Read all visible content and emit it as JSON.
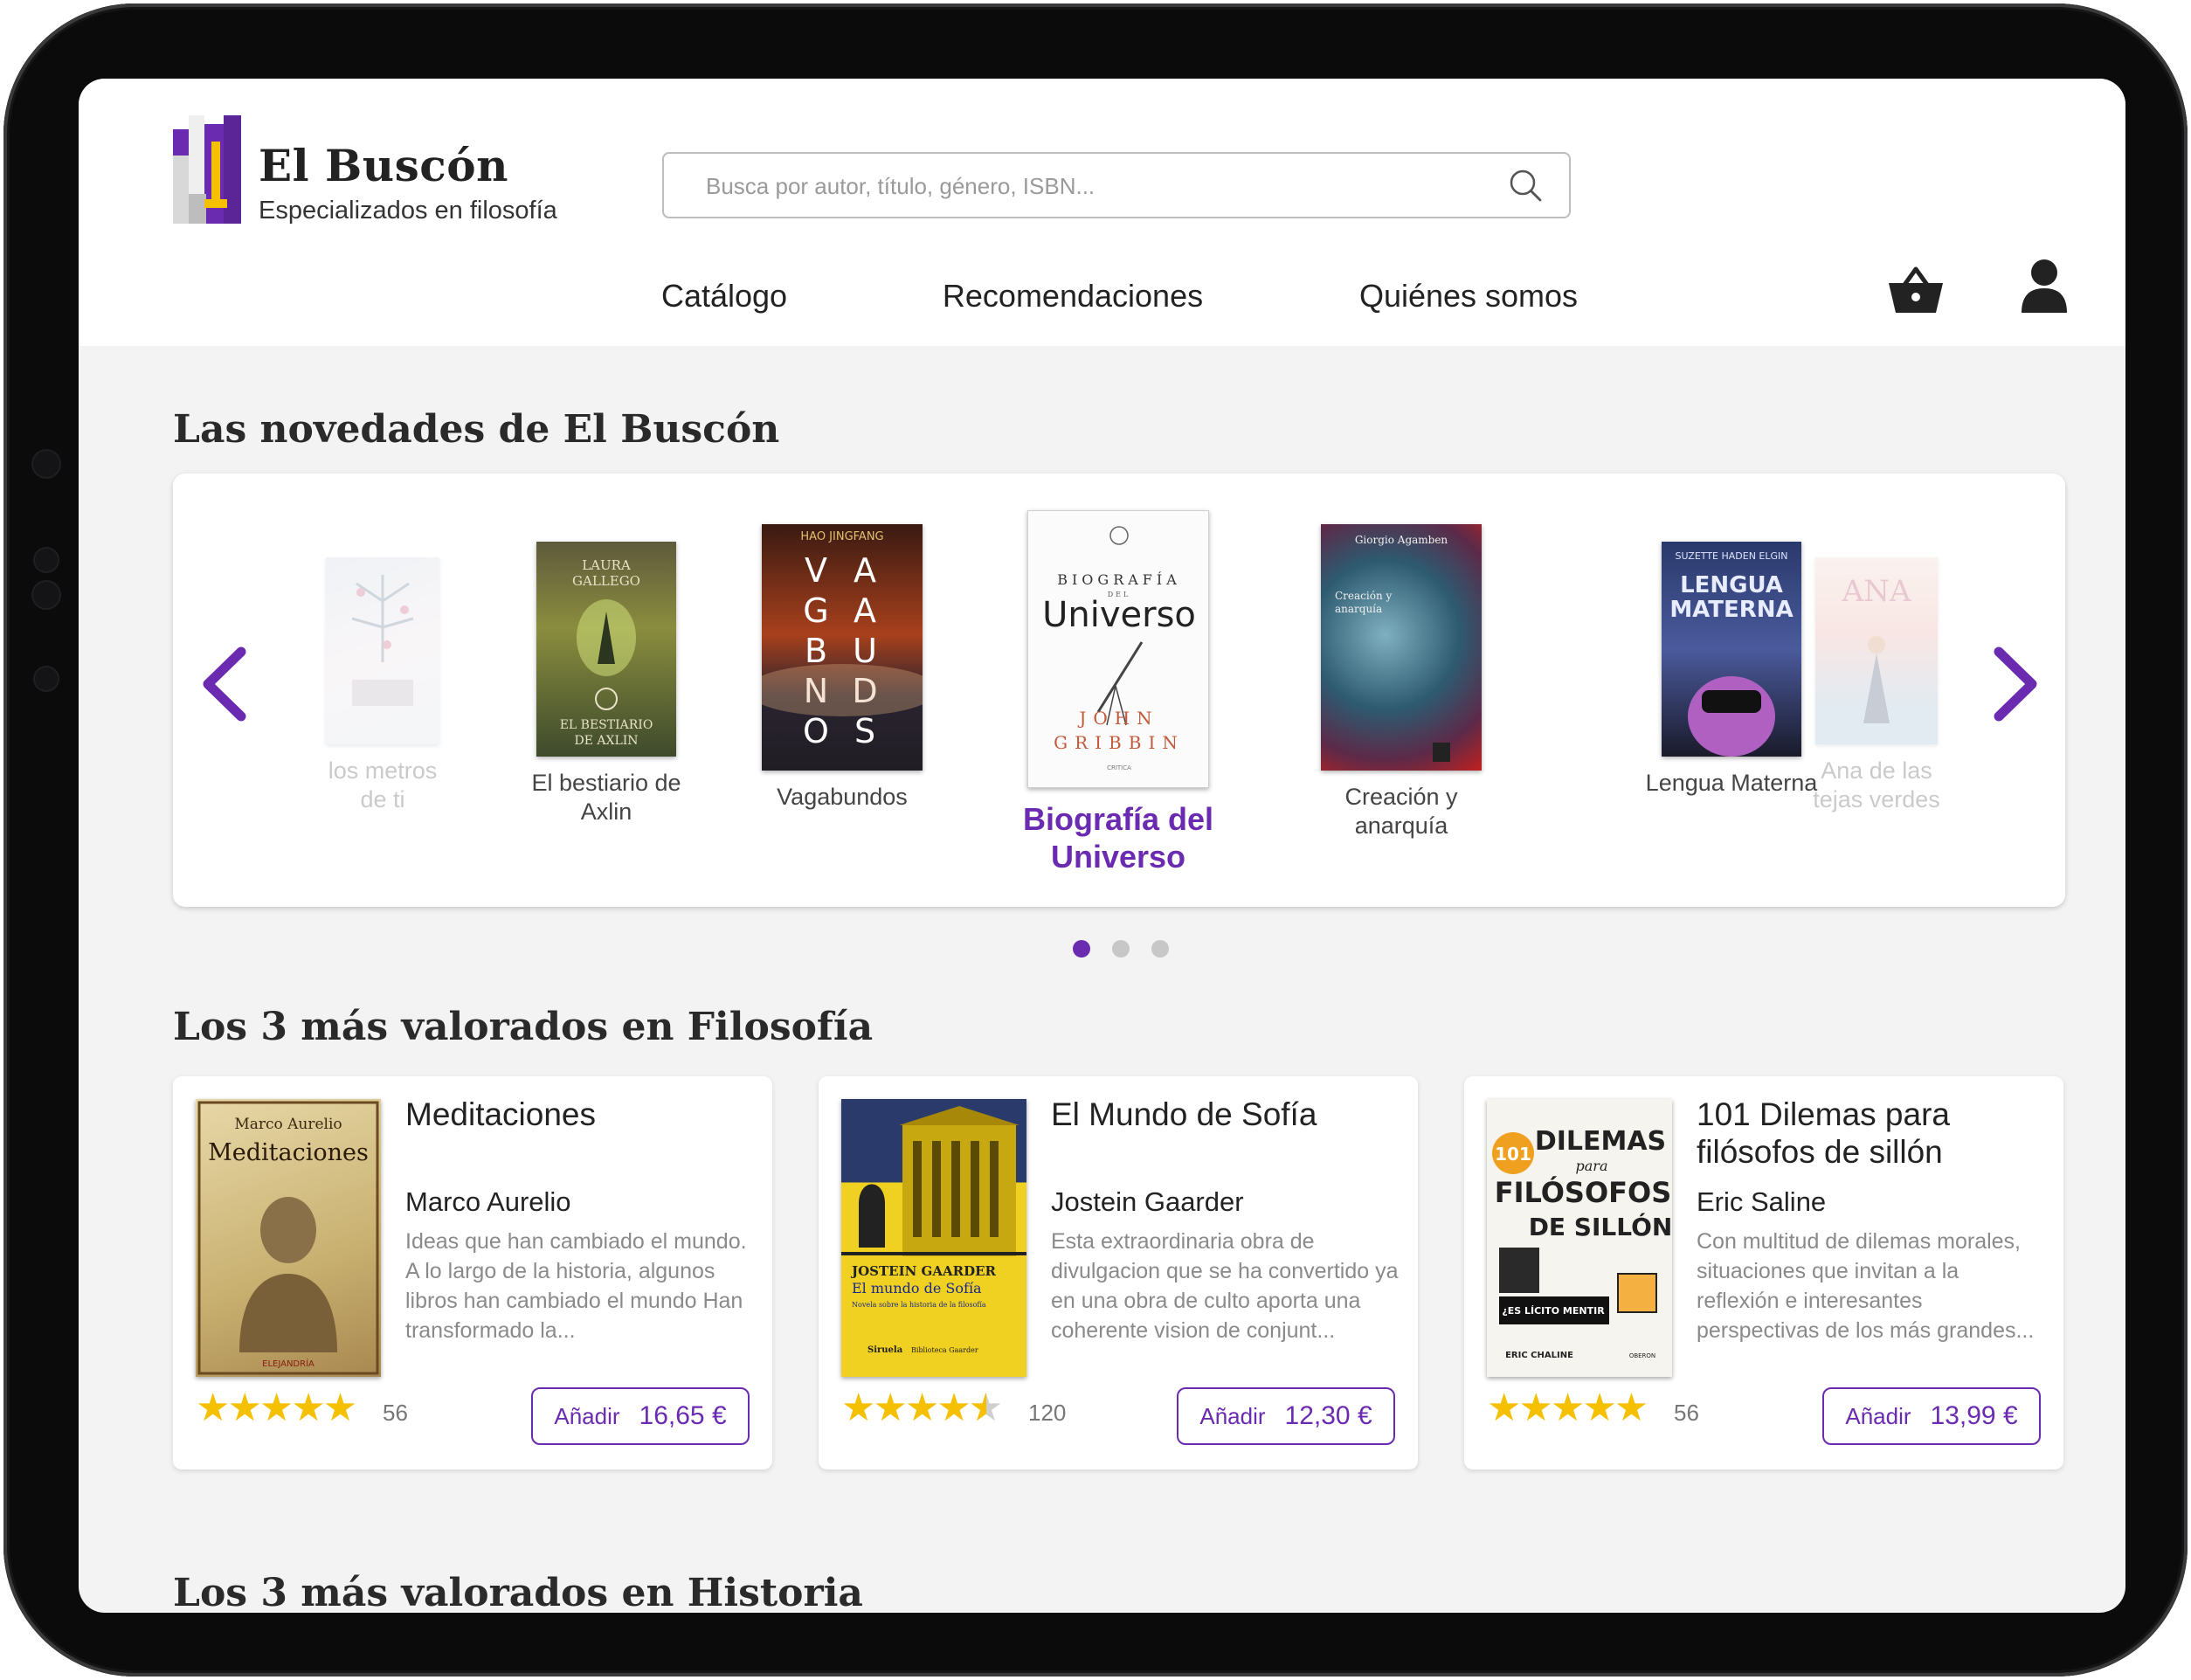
{
  "brand": {
    "name": "El Buscón",
    "tagline": "Especializados en filosofía"
  },
  "search": {
    "placeholder": "Busca por autor, título, género, ISBN..."
  },
  "nav": {
    "items": [
      "Catálogo",
      "Recomendaciones",
      "Quiénes somos"
    ]
  },
  "icons": {
    "search": "search-icon",
    "cart": "basket-icon",
    "user": "user-icon",
    "prev": "chevron-left-icon",
    "next": "chevron-right-icon"
  },
  "colors": {
    "accent": "#6a2bb0",
    "star": "#f4c000",
    "background": "#f3f3f3"
  },
  "novedades": {
    "title": "Las novedades de El Buscón",
    "books": [
      {
        "title": "los metros de ti",
        "cover_text": ""
      },
      {
        "title": "El bestiario de Axlin",
        "cover_text": "LAURA GALLEGO · EL BESTIARIO DE AXLIN"
      },
      {
        "title": "Vagabundos",
        "cover_text": "HAO JINGFANG · VAGABUNDOS"
      },
      {
        "title": "Biografía del Universo",
        "cover_text": "BIOGRAFÍA DEL Universo · JOHN GRIBBIN"
      },
      {
        "title": "Creación y anarquía",
        "cover_text": "Giorgio Agamben · Creación y anarquía"
      },
      {
        "title": "Lengua Materna",
        "cover_text": "SUZETTE HADEN ELGIN · LENGUA MATERNA"
      },
      {
        "title": "Ana de las tejas verdes",
        "cover_text": "ANA DE LAS TEJAS VERDES"
      }
    ],
    "active_index": 3,
    "pages": 3,
    "current_page": 1
  },
  "top_filosofia": {
    "title": "Los 3 más valorados en Filosofía",
    "books": [
      {
        "title": "Meditaciones",
        "author": "Marco Aurelio",
        "description": "Ideas que han cambiado el mundo. A lo largo de la historia, algunos libros han cambiado el mundo Han transformado la...",
        "rating": 5,
        "stars": "★★★★★",
        "reviews": "56",
        "add_label": "Añadir",
        "price": "16,65 €",
        "cover_text": "Marco Aurelio · Meditaciones · ELEJANDRÍA"
      },
      {
        "title": "El Mundo de Sofía",
        "author": "Jostein Gaarder",
        "description": "Esta extraordinaria obra de divulgacion que se ha convertido ya en una obra de culto aporta una coherente vision de conjunt...",
        "rating": 4.5,
        "stars": "★★★★½",
        "reviews": "120",
        "add_label": "Añadir",
        "price": "12,30 €",
        "cover_text": "JOSTEIN GAARDER · El mundo de Sofía · Siruela"
      },
      {
        "title": "101 Dilemas para filósofos de sillón",
        "author": "Eric Saline",
        "description": "Con multitud de dilemas morales, situaciones que invitan a la reflexión e interesantes perspectivas de los más grandes...",
        "rating": 5,
        "stars": "★★★★★",
        "reviews": "56",
        "add_label": "Añadir",
        "price": "13,99 €",
        "cover_text": "101 DILEMAS para FILÓSOFOS DE SILLÓN · ERIC CHALINE"
      }
    ]
  },
  "top_historia": {
    "title": "Los 3 más valorados en Historia"
  }
}
